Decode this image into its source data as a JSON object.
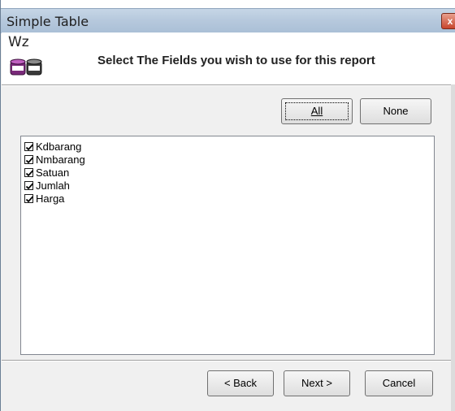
{
  "window": {
    "title": "Simple Table",
    "close_label": "x"
  },
  "header": {
    "logo_text": "Wz",
    "title": "Select The Fields you wish to use for this report"
  },
  "toolbar": {
    "all_label": "All",
    "all_mnemonic": "A",
    "none_label": "None",
    "none_mnemonic": "N"
  },
  "fields": [
    {
      "label": "Kdbarang",
      "checked": true
    },
    {
      "label": "Nmbarang",
      "checked": true
    },
    {
      "label": "Satuan",
      "checked": true
    },
    {
      "label": "Jumlah",
      "checked": true
    },
    {
      "label": "Harga",
      "checked": true
    }
  ],
  "footer": {
    "back_label": "< Back",
    "next_label": "Next >",
    "cancel_label": "Cancel"
  },
  "colors": {
    "titlebar": "#b7c9dd",
    "dialog_bg": "#f0f0f0",
    "close": "#c8452c"
  }
}
